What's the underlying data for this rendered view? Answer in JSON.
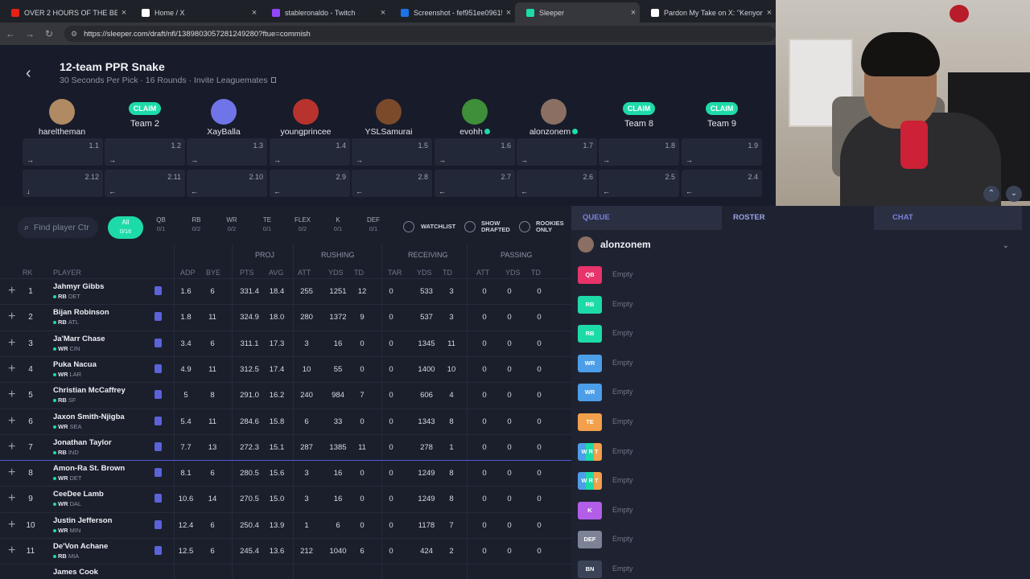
{
  "browser": {
    "tabs": [
      {
        "title": "OVER 2 HOURS OF THE BEST I",
        "icon": "youtube-icon",
        "color": "#e62117"
      },
      {
        "title": "Home / X",
        "icon": "x-icon",
        "color": "#ffffff"
      },
      {
        "title": "stableronaldo - Twitch",
        "icon": "twitch-icon",
        "color": "#9146ff"
      },
      {
        "title": "Screenshot - fef951ee096158d",
        "icon": "screenshot-icon",
        "color": "#1a73e8"
      },
      {
        "title": "Sleeper",
        "icon": "sleeper-icon",
        "color": "#1ddba8"
      },
      {
        "title": "Pardon My Take on X: \"Kenyon",
        "icon": "x-icon",
        "color": "#ffffff"
      }
    ],
    "close_glyph": "×",
    "url": "https://sleeper.com/draft/nfl/1389803057281249280?ftue=commish"
  },
  "draft": {
    "back": "‹",
    "title": "12-team PPR Snake",
    "subtitle": "30 Seconds Per Pick · 16 Rounds · Invite Leaguemates",
    "claim_label": "CLAIM",
    "teams": [
      {
        "name": "hareltheman",
        "claim": false,
        "online": false,
        "avatar_color": "#b08a63"
      },
      {
        "name": "Team 2",
        "claim": true,
        "online": false,
        "avatar_color": ""
      },
      {
        "name": "XayBalla",
        "claim": false,
        "online": false,
        "avatar_color": "#6f74e8"
      },
      {
        "name": "youngprincee",
        "claim": false,
        "online": false,
        "avatar_color": "#b8332e"
      },
      {
        "name": "YSLSamurai",
        "claim": false,
        "online": false,
        "avatar_color": "#7a4a2b"
      },
      {
        "name": "evohh",
        "claim": false,
        "online": true,
        "avatar_color": "#3f8e3a"
      },
      {
        "name": "alonzonem",
        "claim": false,
        "online": true,
        "avatar_color": "#8a6f62"
      },
      {
        "name": "Team 8",
        "claim": true,
        "online": false,
        "avatar_color": ""
      },
      {
        "name": "Team 9",
        "claim": true,
        "online": false,
        "avatar_color": ""
      }
    ],
    "round1": [
      {
        "pick": "1.1",
        "arrow": "→"
      },
      {
        "pick": "1.2",
        "arrow": "→"
      },
      {
        "pick": "1.3",
        "arrow": "→"
      },
      {
        "pick": "1.4",
        "arrow": "→"
      },
      {
        "pick": "1.5",
        "arrow": "→"
      },
      {
        "pick": "1.6",
        "arrow": "→"
      },
      {
        "pick": "1.7",
        "arrow": "→"
      },
      {
        "pick": "1.8",
        "arrow": "→"
      },
      {
        "pick": "1.9",
        "arrow": "→"
      }
    ],
    "round2": [
      {
        "pick": "2.12",
        "arrow": "↓"
      },
      {
        "pick": "2.11",
        "arrow": "←"
      },
      {
        "pick": "2.10",
        "arrow": "←"
      },
      {
        "pick": "2.9",
        "arrow": "←"
      },
      {
        "pick": "2.8",
        "arrow": "←"
      },
      {
        "pick": "2.7",
        "arrow": "←"
      },
      {
        "pick": "2.6",
        "arrow": "←"
      },
      {
        "pick": "2.5",
        "arrow": "←"
      },
      {
        "pick": "2.4",
        "arrow": "←"
      }
    ],
    "scroll_up": "⌃",
    "scroll_down": "⌄"
  },
  "filters": {
    "search_placeholder": "Find player Ctr",
    "positions": [
      {
        "label": "All",
        "count": "0/16",
        "active": true
      },
      {
        "label": "QB",
        "count": "0/1"
      },
      {
        "label": "RB",
        "count": "0/2"
      },
      {
        "label": "WR",
        "count": "0/2"
      },
      {
        "label": "TE",
        "count": "0/1"
      },
      {
        "label": "FLEX",
        "count": "0/2"
      },
      {
        "label": "K",
        "count": "0/1"
      },
      {
        "label": "DEF",
        "count": "0/1"
      }
    ],
    "watchlist": "WATCHLIST",
    "show_drafted_1": "SHOW",
    "show_drafted_2": "DRAFTED",
    "rookies_1": "ROOKIES",
    "rookies_2": "ONLY"
  },
  "table": {
    "groups": {
      "proj": "PROJ",
      "rushing": "RUSHING",
      "receiving": "RECEIVING",
      "passing": "PASSING"
    },
    "columns": [
      "RK",
      "PLAYER",
      "ADP",
      "BYE",
      "PTS",
      "AVG",
      "ATT",
      "YDS",
      "TD",
      "TAR",
      "YDS",
      "TD",
      "ATT",
      "YDS",
      "TD"
    ],
    "rows": [
      {
        "rk": "1",
        "name": "Jahmyr Gibbs",
        "pos": "RB",
        "team": "DET",
        "adp": "1.6",
        "bye": "6",
        "pts": "331.4",
        "avg": "18.4",
        "ratt": "255",
        "ryds": "1251",
        "rtd": "12",
        "tar": "0",
        "recyds": "533",
        "rectd": "3",
        "patt": "0",
        "pyds": "0",
        "ptd": "0"
      },
      {
        "rk": "2",
        "name": "Bijan Robinson",
        "pos": "RB",
        "team": "ATL",
        "adp": "1.8",
        "bye": "11",
        "pts": "324.9",
        "avg": "18.0",
        "ratt": "280",
        "ryds": "1372",
        "rtd": "9",
        "tar": "0",
        "recyds": "537",
        "rectd": "3",
        "patt": "0",
        "pyds": "0",
        "ptd": "0"
      },
      {
        "rk": "3",
        "name": "Ja'Marr Chase",
        "pos": "WR",
        "team": "CIN",
        "adp": "3.4",
        "bye": "6",
        "pts": "311.1",
        "avg": "17.3",
        "ratt": "3",
        "ryds": "16",
        "rtd": "0",
        "tar": "0",
        "recyds": "1345",
        "rectd": "11",
        "patt": "0",
        "pyds": "0",
        "ptd": "0"
      },
      {
        "rk": "4",
        "name": "Puka Nacua",
        "pos": "WR",
        "team": "LAR",
        "adp": "4.9",
        "bye": "11",
        "pts": "312.5",
        "avg": "17.4",
        "ratt": "10",
        "ryds": "55",
        "rtd": "0",
        "tar": "0",
        "recyds": "1400",
        "rectd": "10",
        "patt": "0",
        "pyds": "0",
        "ptd": "0"
      },
      {
        "rk": "5",
        "name": "Christian McCaffrey",
        "pos": "RB",
        "team": "SF",
        "adp": "5",
        "bye": "8",
        "pts": "291.0",
        "avg": "16.2",
        "ratt": "240",
        "ryds": "984",
        "rtd": "7",
        "tar": "0",
        "recyds": "606",
        "rectd": "4",
        "patt": "0",
        "pyds": "0",
        "ptd": "0"
      },
      {
        "rk": "6",
        "name": "Jaxon Smith-Njigba",
        "pos": "WR",
        "team": "SEA",
        "adp": "5.4",
        "bye": "11",
        "pts": "284.6",
        "avg": "15.8",
        "ratt": "6",
        "ryds": "33",
        "rtd": "0",
        "tar": "0",
        "recyds": "1343",
        "rectd": "8",
        "patt": "0",
        "pyds": "0",
        "ptd": "0"
      },
      {
        "rk": "7",
        "name": "Jonathan Taylor",
        "pos": "RB",
        "team": "IND",
        "adp": "7.7",
        "bye": "13",
        "pts": "272.3",
        "avg": "15.1",
        "ratt": "287",
        "ryds": "1385",
        "rtd": "11",
        "tar": "0",
        "recyds": "278",
        "rectd": "1",
        "patt": "0",
        "pyds": "0",
        "ptd": "0"
      },
      {
        "rk": "8",
        "name": "Amon-Ra St. Brown",
        "pos": "WR",
        "team": "DET",
        "adp": "8.1",
        "bye": "6",
        "pts": "280.5",
        "avg": "15.6",
        "ratt": "3",
        "ryds": "16",
        "rtd": "0",
        "tar": "0",
        "recyds": "1249",
        "rectd": "8",
        "patt": "0",
        "pyds": "0",
        "ptd": "0"
      },
      {
        "rk": "9",
        "name": "CeeDee Lamb",
        "pos": "WR",
        "team": "DAL",
        "adp": "10.6",
        "bye": "14",
        "pts": "270.5",
        "avg": "15.0",
        "ratt": "3",
        "ryds": "16",
        "rtd": "0",
        "tar": "0",
        "recyds": "1249",
        "rectd": "8",
        "patt": "0",
        "pyds": "0",
        "ptd": "0"
      },
      {
        "rk": "10",
        "name": "Justin Jefferson",
        "pos": "WR",
        "team": "MIN",
        "adp": "12.4",
        "bye": "6",
        "pts": "250.4",
        "avg": "13.9",
        "ratt": "1",
        "ryds": "6",
        "rtd": "0",
        "tar": "0",
        "recyds": "1178",
        "rectd": "7",
        "patt": "0",
        "pyds": "0",
        "ptd": "0"
      },
      {
        "rk": "11",
        "name": "De'Von Achane",
        "pos": "RB",
        "team": "MIA",
        "adp": "12.5",
        "bye": "6",
        "pts": "245.4",
        "avg": "13.6",
        "ratt": "212",
        "ryds": "1040",
        "rtd": "6",
        "tar": "0",
        "recyds": "424",
        "rectd": "2",
        "patt": "0",
        "pyds": "0",
        "ptd": "0"
      },
      {
        "rk": "",
        "name": "James Cook",
        "pos": "",
        "team": "",
        "adp": "",
        "bye": "",
        "pts": "",
        "avg": "",
        "ratt": "",
        "ryds": "",
        "rtd": "",
        "tar": "",
        "recyds": "",
        "rectd": "",
        "patt": "",
        "pyds": "",
        "ptd": ""
      }
    ]
  },
  "side": {
    "tabs": {
      "queue": "QUEUE",
      "roster": "ROSTER",
      "chat": "CHAT"
    },
    "user": "alonzonem",
    "caret": "⌄",
    "empty": "Empty",
    "slots": [
      {
        "label": "QB",
        "color": "#e8336b"
      },
      {
        "label": "RB",
        "color": "#1ddba8"
      },
      {
        "label": "RB",
        "color": "#1ddba8"
      },
      {
        "label": "WR",
        "color": "#4c9ee8"
      },
      {
        "label": "WR",
        "color": "#4c9ee8"
      },
      {
        "label": "TE",
        "color": "#f2a04b"
      },
      {
        "label": "W R T",
        "color": "flex"
      },
      {
        "label": "W R T",
        "color": "flex"
      },
      {
        "label": "K",
        "color": "#b25ee8"
      },
      {
        "label": "DEF",
        "color": "#7d8396"
      },
      {
        "label": "BN",
        "color": "#3b4357"
      }
    ]
  }
}
